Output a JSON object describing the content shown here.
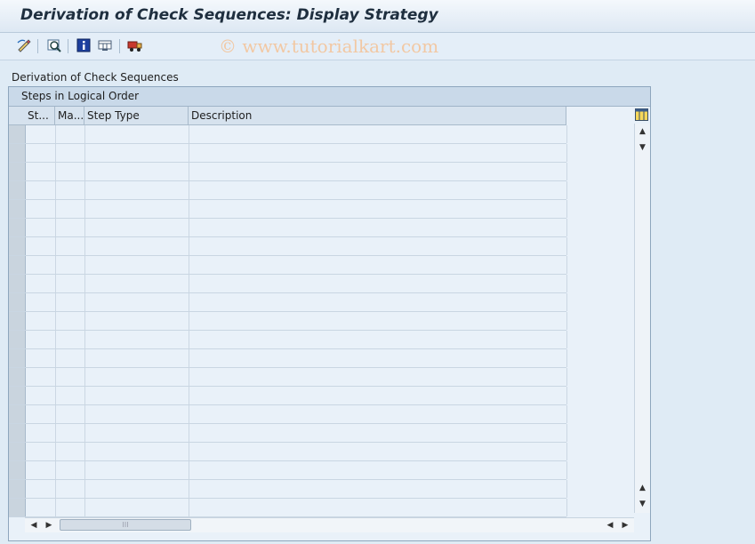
{
  "window": {
    "title": "Derivation of Check Sequences: Display Strategy"
  },
  "toolbar": {
    "buttons": [
      {
        "name": "edit-toggle-icon"
      },
      {
        "name": "other-strategy-icon"
      },
      {
        "name": "info-icon"
      },
      {
        "name": "layout-icon"
      },
      {
        "name": "transport-icon"
      }
    ],
    "watermark": "© www.tutorialkart.com"
  },
  "main": {
    "section_label": "Derivation of Check Sequences",
    "table": {
      "title": "Steps in Logical Order",
      "columns": [
        "St...",
        "Ma...",
        "Step Type",
        "Description"
      ],
      "row_count": 21
    }
  },
  "colors": {
    "background": "#dfebf5",
    "watermark": "#f2c8a3"
  }
}
